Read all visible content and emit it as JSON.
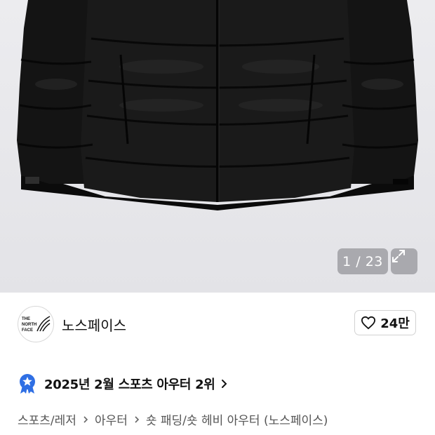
{
  "gallery": {
    "counter": "1 / 23",
    "expand_icon": "expand-arrows-icon"
  },
  "brand": {
    "logo_text": [
      "THE",
      "NORTH",
      "FACE"
    ],
    "name": "노스페이스",
    "like_count": "24만",
    "like_icon": "heart-icon"
  },
  "ranking": {
    "badge_icon": "star-medal-icon",
    "text": "2025년 2월 스포츠 아우터 2위",
    "chevron_icon": "chevron-right-icon"
  },
  "breadcrumb": {
    "items": [
      "스포츠/레저",
      "아우터",
      "숏 패딩/숏 헤비 아우터 (노스페이스)"
    ]
  },
  "colors": {
    "background_gray": "#e6e6ea",
    "badge_blue": "#2f6fe4",
    "text": "#111111",
    "subtext": "#555555"
  }
}
